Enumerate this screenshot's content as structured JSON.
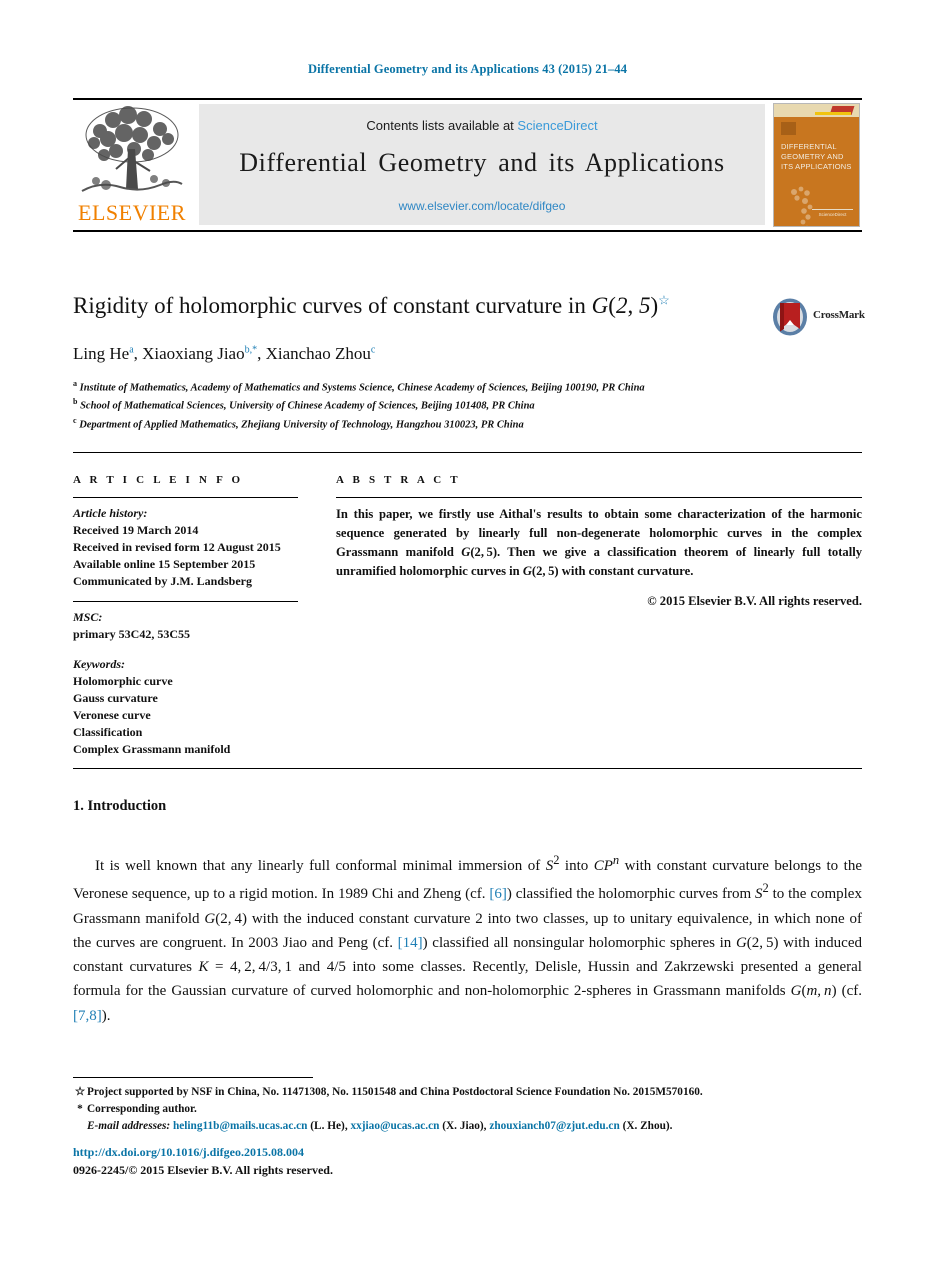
{
  "running_head": "Differential Geometry and its Applications 43 (2015) 21–44",
  "masthead": {
    "publisher_wordmark": "ELSEVIER",
    "contents_prefix": "Contents lists available at",
    "contents_link": "ScienceDirect",
    "journal_name": "Differential Geometry and its Applications",
    "journal_url": "www.elsevier.com/locate/difgeo",
    "cover_title": "DIFFERENTIAL GEOMETRY AND ITS APPLICATIONS",
    "cover_footer": "ScienceDirect",
    "link_color": "#3a9ad9",
    "brand_color": "#f08000",
    "cover_color": "#c8761f"
  },
  "article": {
    "title": "Rigidity of holomorphic curves of constant curvature in G(2, 5)",
    "title_star": "☆",
    "crossmark_label": "CrossMark",
    "authors": [
      {
        "name": "Ling He",
        "sup": "a"
      },
      {
        "name": "Xiaoxiang Jiao",
        "sup": "b,*"
      },
      {
        "name": "Xianchao Zhou",
        "sup": "c"
      }
    ],
    "affiliations": [
      {
        "mark": "a",
        "text": "Institute of Mathematics, Academy of Mathematics and Systems Science, Chinese Academy of Sciences, Beijing 100190, PR China"
      },
      {
        "mark": "b",
        "text": "School of Mathematical Sciences, University of Chinese Academy of Sciences, Beijing 101408, PR China"
      },
      {
        "mark": "c",
        "text": "Department of Applied Mathematics, Zhejiang University of Technology, Hangzhou 310023, PR China"
      }
    ]
  },
  "article_info": {
    "heading": "A R T I C L E   I N F O",
    "history_label": "Article history:",
    "history": [
      "Received 19 March 2014",
      "Received in revised form 12 August 2015",
      "Available online 15 September 2015",
      "Communicated by J.M. Landsberg"
    ],
    "msc_label": "MSC:",
    "msc": "primary 53C42, 53C55",
    "keywords_label": "Keywords:",
    "keywords": [
      "Holomorphic curve",
      "Gauss curvature",
      "Veronese curve",
      "Classification",
      "Complex Grassmann manifold"
    ]
  },
  "abstract": {
    "heading": "A B S T R A C T",
    "text": "In this paper, we firstly use Aithal's results to obtain some characterization of the harmonic sequence generated by linearly full non-degenerate holomorphic curves in the complex Grassmann manifold G(2, 5). Then we give a classification theorem of linearly full totally unramified holomorphic curves in G(2, 5) with constant curvature.",
    "copyright": "© 2015 Elsevier B.V. All rights reserved."
  },
  "body": {
    "section_number_title": "1. Introduction",
    "paragraph": "It is well known that any linearly full conformal minimal immersion of S2 into CPn with constant curvature belongs to the Veronese sequence, up to a rigid motion. In 1989 Chi and Zheng (cf. [6]) classified the holomorphic curves from S2 to the complex Grassmann manifold G(2, 4) with the induced constant curvature 2 into two classes, up to unitary equivalence, in which none of the curves are congruent. In 2003 Jiao and Peng (cf. [14]) classified all nonsingular holomorphic spheres in G(2, 5) with induced constant curvatures K = 4, 2, 4/3, 1 and 4/5 into some classes. Recently, Delisle, Hussin and Zakrzewski presented a general formula for the Gaussian curvature of curved holomorphic and non-holomorphic 2-spheres in Grassmann manifolds G(m, n) (cf. [7,8]).",
    "references_inline": [
      "[6]",
      "[14]",
      "[7,8]"
    ]
  },
  "footnotes": {
    "star_mark": "☆",
    "star_text": "Project supported by NSF in China, No. 11471308, No. 11501548 and China Postdoctoral Science Foundation No. 2015M570160.",
    "asterisk_mark": "*",
    "asterisk_text": "Corresponding author.",
    "email_label": "E-mail addresses:",
    "emails": [
      {
        "address": "heling11b@mails.ucas.ac.cn",
        "owner": "(L. He)"
      },
      {
        "address": "xxjiao@ucas.ac.cn",
        "owner": "(X. Jiao)"
      },
      {
        "address": "zhouxianch07@zjut.edu.cn",
        "owner": "(X. Zhou)"
      }
    ]
  },
  "footer": {
    "doi": "http://dx.doi.org/10.1016/j.difgeo.2015.08.004",
    "issn_line": "0926-2245/© 2015 Elsevier B.V. All rights reserved."
  }
}
